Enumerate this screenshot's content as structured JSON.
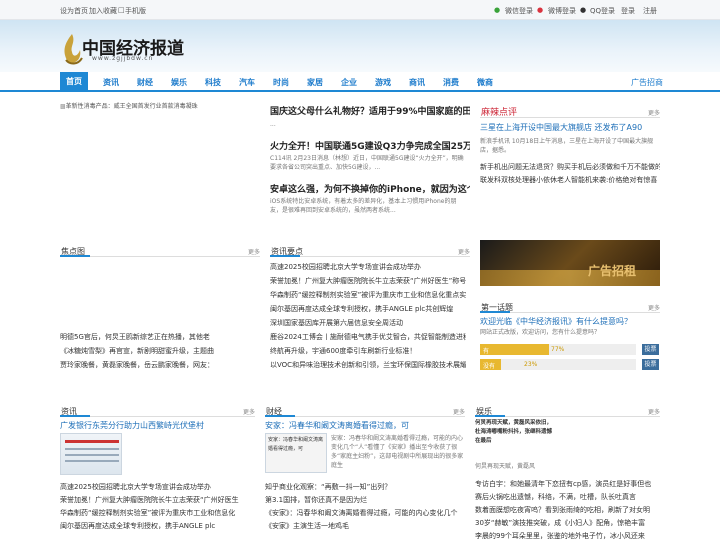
{
  "topbar": {
    "home": "设为首页",
    "fav": "加入收藏",
    "mobile": "手机版",
    "wechat": "微信登录",
    "weibo": "微博登录",
    "qq": "QQ登录",
    "login": "登录",
    "register": "注册"
  },
  "logo": {
    "text": "中国经济报道",
    "url": "www.zgjjbdw.cn"
  },
  "nav": {
    "items": [
      "首页",
      "资讯",
      "财经",
      "娱乐",
      "科技",
      "汽车",
      "时尚",
      "家居",
      "企业",
      "游戏",
      "商讯",
      "消费",
      "微商"
    ],
    "ad": "广告招商"
  },
  "banner_img": "革新性消毒产品：威王全国首发行业首款消毒凝珠",
  "headlines": [
    {
      "title": "国庆这父母什么礼物好？适用于99%中国家庭的田螺云",
      "desc": "..."
    },
    {
      "title": "火力全开！中国联通5G建设Q3力争完成全国25万基",
      "desc": "C114讯 2月23日消息（林想）近日，中国联通5G建设“火力全开”，明确要求各省公司突出重点、加快5G建设，..."
    },
    {
      "title": "安卓这么强，为何不换掉你的iPhone，就因为这个",
      "desc": "iOS系统特比安卓系统，有着太多的差异化，基本上习惯用iPhone的朋友，是很难再回到安卓系统的，虽然两者系统..."
    }
  ],
  "mala": {
    "title": "麻辣点评",
    "more": "更多",
    "headline": "三星在上海开设中国最大旗舰店 还发布了A90",
    "desc": "新浪手机讯 10月18日上午消息，三星在上海开设了中国最大旗舰店，据悉。",
    "news": [
      "新手机出问题无法退货？购买手机后必须做和千万不能做的事",
      "联发科双核处理器小依休老人智能机来袭:价格绝对有惊喜"
    ]
  },
  "focus": {
    "title": "焦点图",
    "more": "更多",
    "lines": [
      "明德5G官后，何炅王鸥新综艺正在热播，其他老",
      "《冰糖炖雪梨》再官宣，新剧明甜蜜升级，主题曲",
      "贾玲家晚餐，黄磊家晚餐，岳云鹏家晚餐，网友："
    ]
  },
  "news_main": {
    "title": "资讯要点",
    "more": "更多",
    "items": [
      "高速2025校园招聘北京大学专场宣讲会成功举办",
      "荣誉加冕！广州复大肿瘤医院院长牛立志荣获“广州好医生”称号",
      "华森制药“缓控释制剂实验室”被评为重庆市工业和信息化重点实验室",
      "闽尔基因再度达成全球专利授权，携手ANGLE plc共创辉煌",
      "深圳国家基因库开展第六届信息安全周活动",
      "鹿谷2024工博会丨施耐德电气携手优艾智合，共促智能制造进程",
      "终航再升级，宇通600度牵引车刷新行业标准！",
      "以VOC和异味治理技术创新和引领，兰宝环保国际橡胶技术展耀眼光"
    ]
  },
  "ad_block": {
    "text": "广告招租"
  },
  "poll": {
    "title": "第一话题",
    "more": "更多",
    "question": "欢迎光临《中华经济报讯》有什么提意吗？",
    "sub": "网站正式改版，欢迎访问，您有什么提意吗？",
    "options": [
      {
        "label": "有",
        "pct": "77%",
        "value": 77,
        "btn": "投票"
      },
      {
        "label": "没有",
        "pct": "23%",
        "value": 23,
        "btn": "投票"
      }
    ]
  },
  "zixun": {
    "title": "资讯",
    "more": "更多",
    "top": "广发银行东莞分行助力山西繁峙光伏堡村",
    "items": [
      "高速2025校园招聘北京大学专场宣讲会成功举办",
      "荣誉加冕！广州复大肿瘤医院院长牛立志荣获“广州好医生",
      "华森制药“缓控释制剂实验室”被评为重庆市工业和信息化",
      "闽尔基因再度达成全球专利授权，携手ANGLE plc"
    ]
  },
  "caijing": {
    "title": "财经",
    "more": "更多",
    "top": "安家：冯春华和阚文涛离婚看得过瘾，可",
    "img_caption": "安家：冯春华和阚文涛离婚看得过瘾，可",
    "desc": "安家：冯春华和阚文涛离婚看得过瘾，可能的内心变化几个“人”看懂了《安家》播出至今收获了很多“家庭主妇粉”，这部电视剧中所展现出的很多家庭生",
    "items": [
      "知乎商业化观察：“再敷一抖一知”出列？",
      "第3.1国排，暂你还真不是因为烂",
      "《安家》：冯春华和阚文涛离婚看得过瘾，可能的内心变化几个",
      "《安家》主演生活一地鸡毛"
    ]
  },
  "yule": {
    "title": "娱乐",
    "more": "更多",
    "img_text": "何炅再现天赋，黄磊风采依旧，杜海涛嘟嘴粉抖抖，张继科遗憾在最后",
    "caption": "何炅再现天赋，黄磊风",
    "items": [
      "专访白宇：和她最清年下恋扭有cp感，演员红是好事但也",
      "赛后火锅吃出遗憾，科络，不满，吐槽，队长吐真言",
      "数着面膜想吃夜宵呜？看到张雨绮的吃相，刷新了对女明",
      "30岁“赫敏”演技推突破，成《小妇人》配角，惊艳丰富",
      "李晨的99个耳朵里里，张鉴的地外电子竹，冰小风还来"
    ]
  }
}
